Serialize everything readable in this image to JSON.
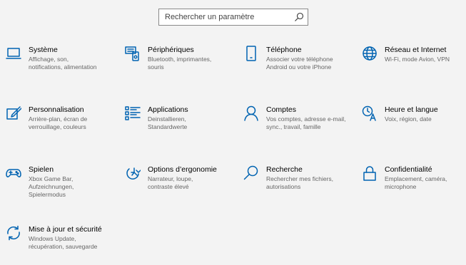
{
  "search": {
    "placeholder": "Rechercher un paramètre"
  },
  "colors": {
    "accent": "#0063b1",
    "background": "#f3f3f3",
    "desc_text": "#666666"
  },
  "tiles": [
    {
      "title": "Système",
      "desc_lines": [
        "Affichage, son,",
        "notifications, alimentation"
      ],
      "icon": "laptop-icon"
    },
    {
      "title": "Périphériques",
      "desc_lines": [
        "Bluetooth, imprimantes,",
        "souris"
      ],
      "icon": "devices-icon"
    },
    {
      "title": "Téléphone",
      "desc_lines": [
        "Associer votre téléphone",
        "Android ou votre iPhone"
      ],
      "icon": "phone-icon"
    },
    {
      "title": "Réseau et Internet",
      "desc_lines": [
        "Wi-Fi, mode Avion, VPN"
      ],
      "icon": "globe-icon"
    },
    {
      "title": "Personnalisation",
      "desc_lines": [
        "Arrière-plan, écran de",
        "verrouillage, couleurs"
      ],
      "icon": "paint-icon"
    },
    {
      "title": "Applications",
      "desc_lines": [
        "Deinstallieren,",
        "Standardwerte"
      ],
      "icon": "apps-list-icon"
    },
    {
      "title": "Comptes",
      "desc_lines": [
        "Vos comptes, adresse e-mail,",
        "sync., travail, famille"
      ],
      "icon": "person-icon"
    },
    {
      "title": "Heure et langue",
      "desc_lines": [
        "Voix, région, date"
      ],
      "icon": "time-language-icon"
    },
    {
      "title": "Spielen",
      "desc_lines": [
        "Xbox Game Bar,",
        "Aufzeichnungen,",
        "Spielermodus"
      ],
      "icon": "gamepad-icon"
    },
    {
      "title": "Options d’ergonomie",
      "desc_lines": [
        "Narrateur, loupe,",
        "contraste élevé"
      ],
      "icon": "ease-of-access-icon"
    },
    {
      "title": "Recherche",
      "desc_lines": [
        "Rechercher mes fichiers,",
        "autorisations"
      ],
      "icon": "search-icon"
    },
    {
      "title": "Confidentialité",
      "desc_lines": [
        "Emplacement, caméra,",
        "microphone"
      ],
      "icon": "lock-icon"
    },
    {
      "title": "Mise à jour et sécurité",
      "desc_lines": [
        "Windows Update,",
        "récupération, sauvegarde"
      ],
      "icon": "update-icon"
    }
  ]
}
